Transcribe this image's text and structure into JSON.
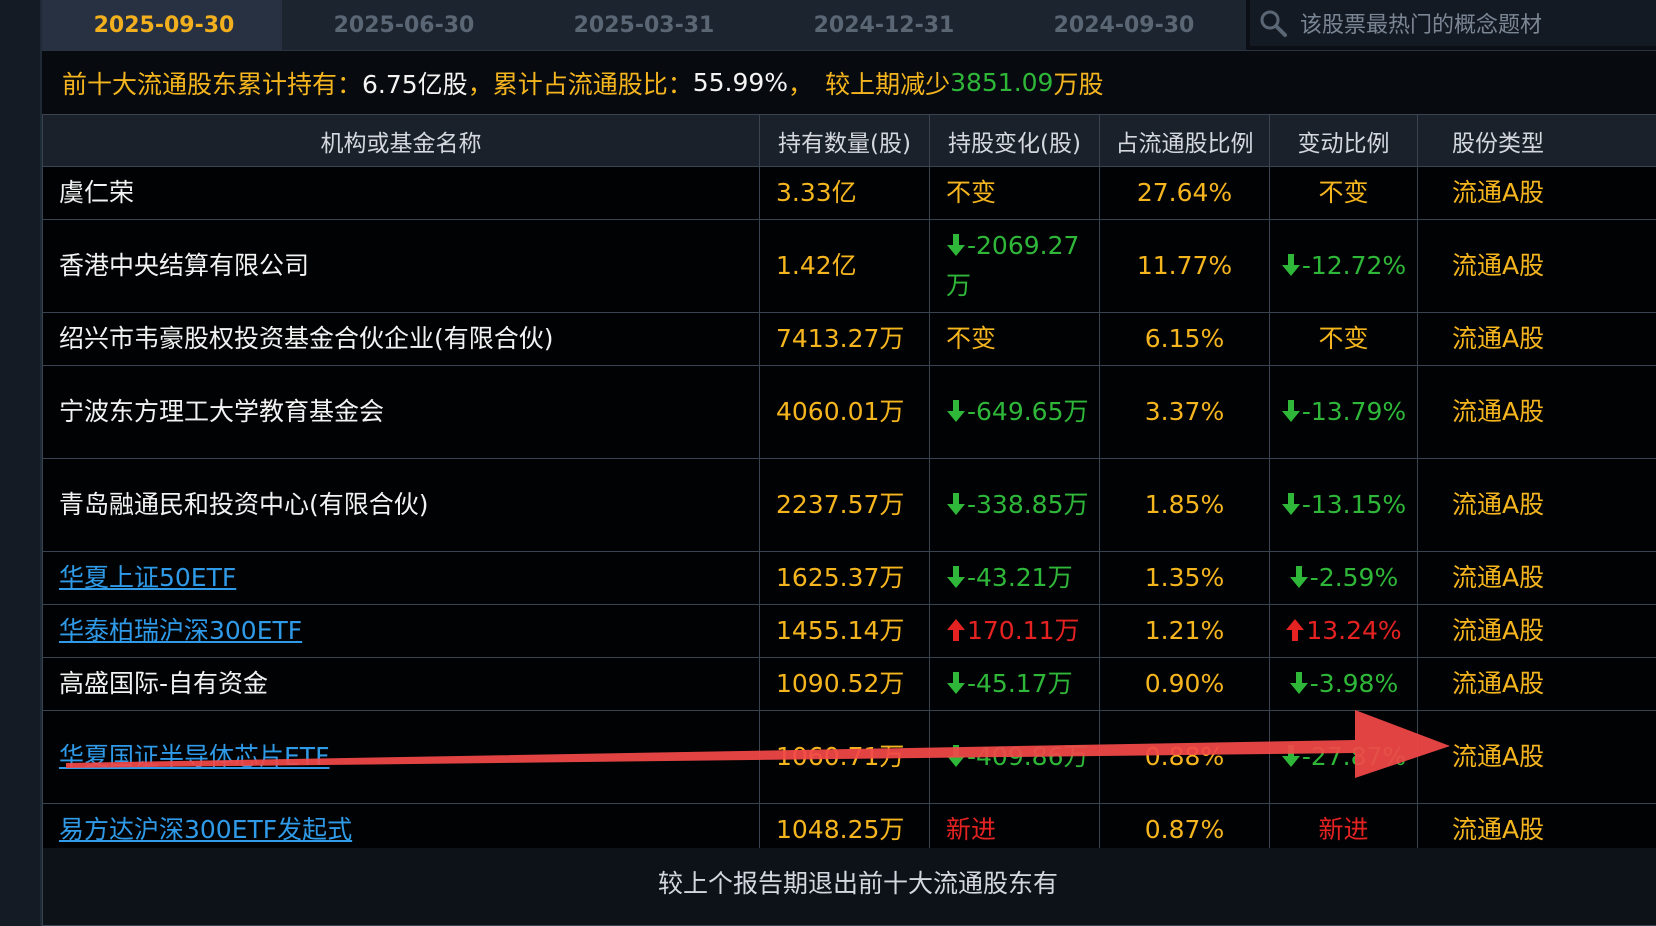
{
  "tabs": [
    {
      "label": "2025-09-30",
      "active": true
    },
    {
      "label": "2025-06-30",
      "active": false
    },
    {
      "label": "2025-03-31",
      "active": false
    },
    {
      "label": "2024-12-31",
      "active": false
    },
    {
      "label": "2024-09-30",
      "active": false
    }
  ],
  "search": {
    "placeholder": "该股票最热门的概念题材"
  },
  "summary": {
    "label1": "前十大流通股东累计持有：",
    "value1": "6.75亿股",
    "sep1": "，",
    "label2": "累计占流通股比：",
    "value2": "55.99%",
    "sep2": " ，",
    "label3": "较上期减少",
    "value3": "3851.09",
    "unit3": "万股"
  },
  "table": {
    "headers": [
      "机构或基金名称",
      "持有数量(股)",
      "持股变化(股)",
      "占流通股比例",
      "变动比例",
      "股份类型"
    ],
    "rows": [
      {
        "name": "虞仁荣",
        "link": false,
        "qty": "3.33亿",
        "change": "不变",
        "change_dir": "none",
        "ratio": "27.64%",
        "pct": "不变",
        "pct_dir": "none",
        "type": "流通A股",
        "tall": false
      },
      {
        "name": "香港中央结算有限公司",
        "link": false,
        "qty": "1.42亿",
        "change": "-2069.27万",
        "change_dir": "down",
        "ratio": "11.77%",
        "pct": "-12.72%",
        "pct_dir": "down",
        "type": "流通A股",
        "tall": true
      },
      {
        "name": "绍兴市韦豪股权投资基金合伙企业(有限合伙)",
        "link": false,
        "qty": "7413.27万",
        "change": "不变",
        "change_dir": "none",
        "ratio": "6.15%",
        "pct": "不变",
        "pct_dir": "none",
        "type": "流通A股",
        "tall": false
      },
      {
        "name": "宁波东方理工大学教育基金会",
        "link": false,
        "qty": "4060.01万",
        "change": "-649.65万",
        "change_dir": "down",
        "ratio": "3.37%",
        "pct": "-13.79%",
        "pct_dir": "down",
        "type": "流通A股",
        "tall": true
      },
      {
        "name": "青岛融通民和投资中心(有限合伙)",
        "link": false,
        "qty": "2237.57万",
        "change": "-338.85万",
        "change_dir": "down",
        "ratio": "1.85%",
        "pct": "-13.15%",
        "pct_dir": "down",
        "type": "流通A股",
        "tall": true
      },
      {
        "name": "华夏上证50ETF",
        "link": true,
        "qty": "1625.37万",
        "change": "-43.21万",
        "change_dir": "down",
        "ratio": "1.35%",
        "pct": "-2.59%",
        "pct_dir": "down",
        "type": "流通A股",
        "tall": false
      },
      {
        "name": "华泰柏瑞沪深300ETF",
        "link": true,
        "qty": "1455.14万",
        "change": "170.11万",
        "change_dir": "up",
        "ratio": "1.21%",
        "pct": "13.24%",
        "pct_dir": "up",
        "type": "流通A股",
        "tall": false
      },
      {
        "name": "高盛国际-自有资金",
        "link": false,
        "qty": "1090.52万",
        "change": "-45.17万",
        "change_dir": "down",
        "ratio": "0.90%",
        "pct": "-3.98%",
        "pct_dir": "down",
        "type": "流通A股",
        "tall": false
      },
      {
        "name": "华夏国证半导体芯片ETF",
        "link": true,
        "qty": "1060.71万",
        "change": "-409.86万",
        "change_dir": "down",
        "ratio": "0.88%",
        "pct": "-27.87%",
        "pct_dir": "down",
        "type": "流通A股",
        "tall": true
      },
      {
        "name": "易方达沪深300ETF发起式",
        "link": true,
        "qty": "1048.25万",
        "change": "新进",
        "change_dir": "new",
        "ratio": "0.87%",
        "pct": "新进",
        "pct_dir": "new",
        "type": "流通A股",
        "tall": false
      }
    ]
  },
  "footer": {
    "label": "较上个报告期退出前十大流通股东有"
  },
  "colors": {
    "accent": "#f5b51f",
    "down": "#2fb73a",
    "up": "#e42222",
    "link": "#2f9be8",
    "annotation_arrow": "#f24848"
  }
}
